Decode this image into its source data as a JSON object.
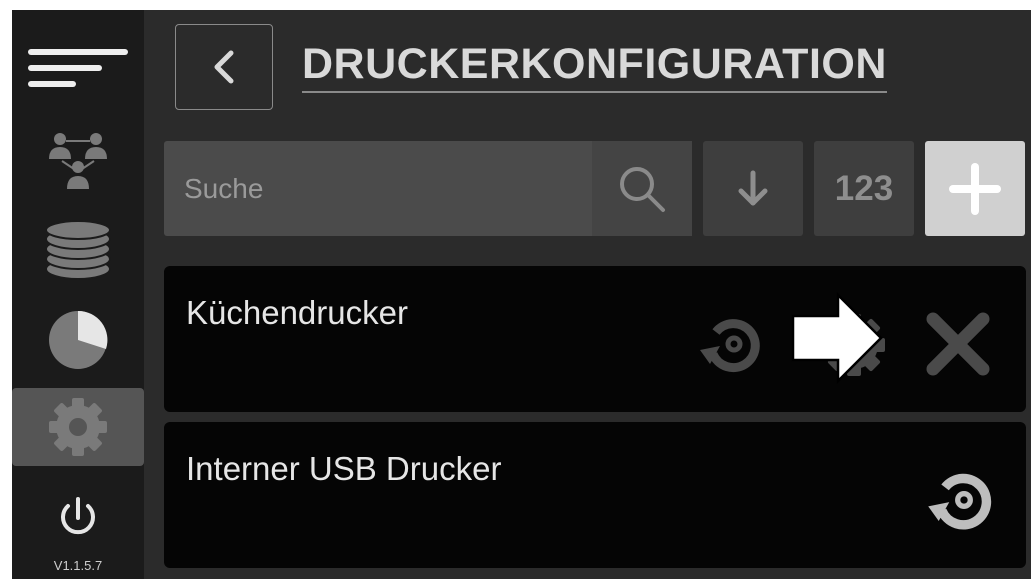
{
  "sidebar": {
    "items": [
      {
        "icon": "menu-icon"
      },
      {
        "icon": "users-network-icon"
      },
      {
        "icon": "database-icon"
      },
      {
        "icon": "pie-chart-icon"
      },
      {
        "icon": "gear-icon",
        "active": true
      },
      {
        "icon": "power-icon"
      }
    ],
    "version": "V1.1.5.7"
  },
  "header": {
    "back_icon": "chevron-left-icon",
    "title": "DRUCKERKONFIGURATION"
  },
  "toolbar": {
    "search_placeholder": "Suche",
    "sort_icon": "arrow-down-icon",
    "number_label": "123",
    "add_icon": "plus-icon"
  },
  "printers": [
    {
      "name": "Küchendrucker",
      "actions": [
        "refresh-icon",
        "gear-icon",
        "close-icon"
      ]
    },
    {
      "name": "Interner USB Drucker",
      "actions": [
        "refresh-icon"
      ]
    }
  ],
  "colors": {
    "background": "#2b2b2b",
    "sidebar": "#1b1b1b",
    "row": "#050505",
    "active_item": "#555555",
    "text": "#d9d9d9",
    "icon_muted": "#6f6f6f"
  }
}
